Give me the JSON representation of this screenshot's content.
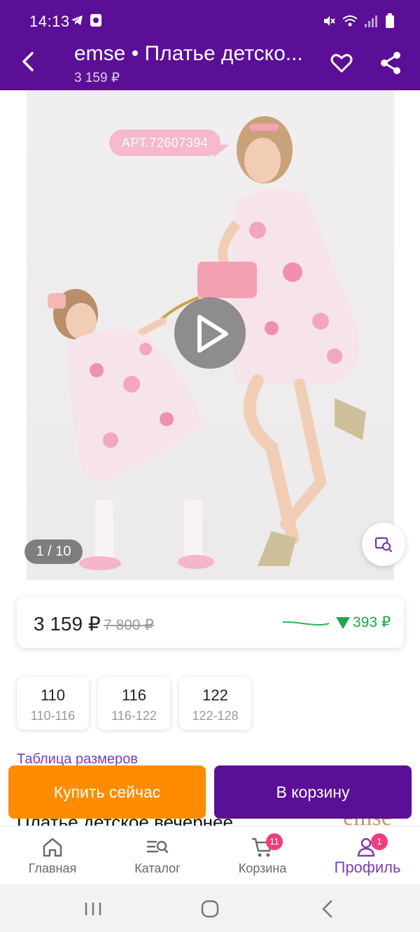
{
  "status_bar": {
    "time": "14:13"
  },
  "header": {
    "title": "emse • Платье детско...",
    "price": "3 159 ₽"
  },
  "gallery": {
    "article_badge": "АРТ.72607394",
    "counter": "1 / 10"
  },
  "price_card": {
    "current": "3 159 ₽",
    "old": "7 800 ₽",
    "drop": "393 ₽",
    "drop_color": "#1ca84a"
  },
  "sizes": [
    {
      "size": "110",
      "range": "110-116"
    },
    {
      "size": "116",
      "range": "116-122"
    },
    {
      "size": "122",
      "range": "122-128"
    }
  ],
  "size_table_link": "Таблица размеров",
  "product_name": "Платье детское вечернее",
  "brand_logo": "emse",
  "actions": {
    "buy_now": "Купить сейчас",
    "add_to_cart": "В корзину"
  },
  "bottom_nav": {
    "items": [
      {
        "label": "Главная",
        "icon": "home-icon"
      },
      {
        "label": "Каталог",
        "icon": "catalog-search-icon"
      },
      {
        "label": "Корзина",
        "icon": "cart-icon",
        "badge": "11"
      },
      {
        "label": "Профиль",
        "icon": "profile-icon",
        "badge": "1",
        "active": true
      }
    ]
  },
  "colors": {
    "brand_purple": "#5a0f96",
    "buy_orange": "#ff8c00",
    "badge_pink": "#f03e7a",
    "active_purple": "#7a3fb8"
  }
}
